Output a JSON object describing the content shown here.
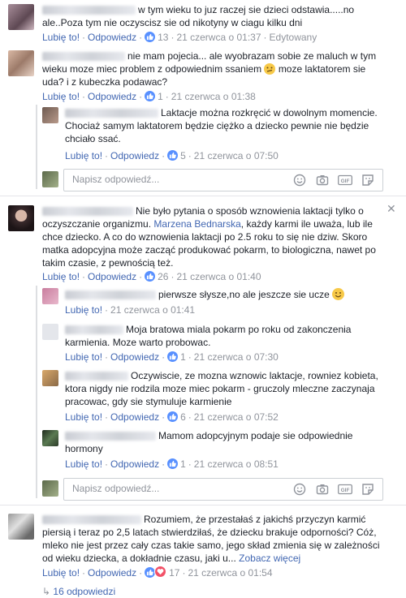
{
  "actions": {
    "like": "Lubię to!",
    "reply": "Odpowiedz",
    "edited": "Edytowany",
    "see_more": "Zobacz więcej"
  },
  "reply_placeholder": "Napisz odpowiedź...",
  "comments": [
    {
      "text": "w tym wieku to juz raczej sie dzieci odstawia.....no ale..Poza tym nie oczyscisz sie od nikotyny w ciagu kilku dni",
      "likes": "13",
      "time": "21 czerwca o 01:37"
    },
    {
      "text_1": "nie mam pojecia... ale wyobrazam sobie ze maluch w tym wieku moze miec problem z odpowiednim ssaniem",
      "text_2": "moze laktatorem sie uda? i z kubeczka podawac?",
      "likes": "1",
      "time": "21 czerwca o 01:38",
      "replies": [
        {
          "text": "Laktacje można rozkręcić w dowolnym momencie. Chociaż samym laktatorem będzie ciężko a dziecko pewnie nie będzie chciało ssać.",
          "likes": "5",
          "time": "21 czerwca o 07:50"
        }
      ]
    },
    {
      "text_1": "Nie było pytania o sposób wznowienia laktacji tylko o oczyszczanie organizmu.",
      "mention": "Marzena Bednarska",
      "text_2": ", każdy karmi ile uważa, lub ile chce dziecko. A co do wznowienia laktacji po 2.5 roku to się nie dziw. Skoro matka adopcyjna może zacząć produkować pokarm, to biologiczna, nawet po takim czasie, z pewnością też.",
      "likes": "26",
      "time": "21 czerwca o 01:40",
      "replies": [
        {
          "text": "pierwsze słysze,no ale jeszcze sie ucze",
          "time": "21 czerwca o 01:41"
        },
        {
          "text": "Moja bratowa miala pokarm po roku od zakonczenia karmienia. Moze warto probowac.",
          "likes": "1",
          "time": "21 czerwca o 07:30"
        },
        {
          "text": "Oczywiscie, ze mozna wznowic laktacje, rowniez kobieta, ktora nigdy nie rodzila moze miec pokarm - gruczoly mleczne zaczynaja pracowac, gdy sie stymuluje karmienie",
          "likes": "6",
          "time": "21 czerwca o 07:52"
        },
        {
          "text": "Mamom adopcyjnym podaje sie odpowiednie hormony",
          "likes": "1",
          "time": "21 czerwca o 08:51"
        }
      ]
    },
    {
      "text": "Rozumiem, że przestałaś z jakichś przyczyn karmić piersią i teraz po 2,5 latach stwierdziłaś, że dziecku brakuje odporności? Cóż, mleko nie jest przez cały czas takie samo, jego skład zmienia się w zależności od wieku dziecka, a dokładnie czasu, jaki u...",
      "likes": "17",
      "time": "21 czerwca o 01:54",
      "replies_count": "16 odpowiedzi"
    }
  ]
}
